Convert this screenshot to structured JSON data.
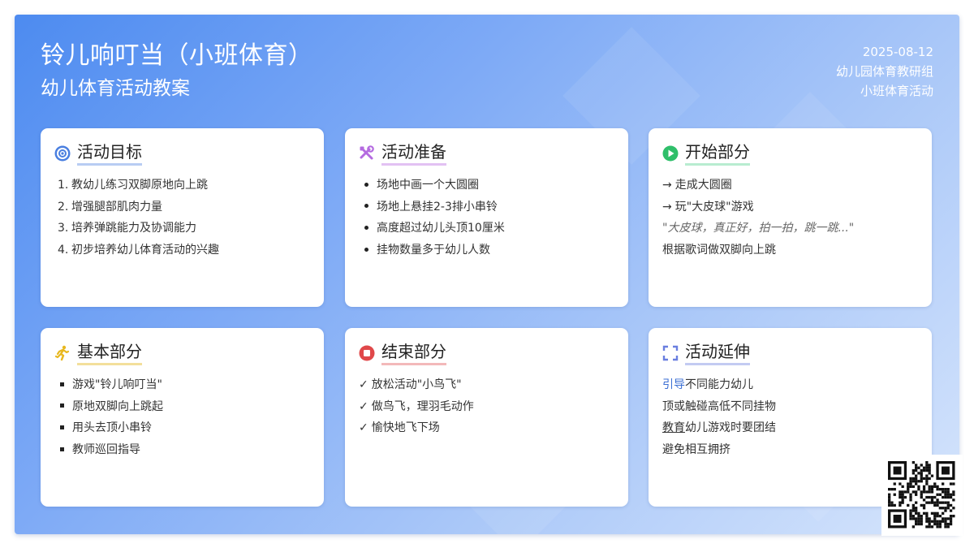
{
  "header": {
    "title": "铃儿响叮当（小班体育）",
    "subtitle": "幼儿体育活动教案",
    "date": "2025-08-12",
    "org": "幼儿园体育教研组",
    "category": "小班体育活动"
  },
  "colors": {
    "goal": "#4a7fe0",
    "prep": "#b46ae0",
    "start": "#2fbf6a",
    "basic": "#e8b820",
    "end": "#e0484a",
    "ext": "#6a7fe0"
  },
  "cards": {
    "goal": {
      "icon": "target-icon",
      "title": "活动目标",
      "items": [
        {
          "n": "1.",
          "text": "教幼儿练习双脚原地向上跳"
        },
        {
          "n": "2.",
          "text": "增强腿部肌肉力量"
        },
        {
          "n": "3.",
          "text": "培养弹跳能力及协调能力"
        },
        {
          "n": "4.",
          "text": "初步培养幼儿体育活动的兴趣"
        }
      ]
    },
    "prep": {
      "icon": "tools-icon",
      "title": "活动准备",
      "items": [
        "场地中画一个大圆圈",
        "场地上悬挂2-3排小串铃",
        "高度超过幼儿头顶10厘米",
        "挂物数量多于幼儿人数"
      ]
    },
    "start": {
      "icon": "play-icon",
      "title": "开始部分",
      "arrow": "→",
      "line1": "走成大圆圈",
      "line2": "玩\"大皮球\"游戏",
      "quote": "\"大皮球，真正好，拍一拍，跳一跳...\"",
      "line4": "根据歌词做双脚向上跳"
    },
    "basic": {
      "icon": "running-icon",
      "title": "基本部分",
      "items": [
        "游戏\"铃儿响叮当\"",
        "原地双脚向上跳起",
        "用头去顶小串铃",
        "教师巡回指导"
      ]
    },
    "end": {
      "icon": "stop-icon",
      "title": "结束部分",
      "check": "✓",
      "items": [
        "放松活动\"小鸟飞\"",
        "做鸟飞，理羽毛动作",
        "愉快地飞下场"
      ]
    },
    "ext": {
      "icon": "expand-icon",
      "title": "活动延伸",
      "l1a": "引导",
      "l1b": "不同能力幼儿",
      "l2": "顶或触碰高低不同挂物",
      "l3a": "教育",
      "l3b": "幼儿游戏时要团结",
      "l4": "避免相互拥挤"
    }
  },
  "qr": {
    "icon": "qr-code-icon"
  }
}
